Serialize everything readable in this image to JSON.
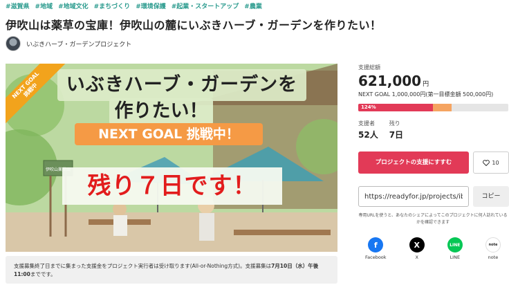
{
  "tags": [
    "#滋賀県",
    "#地域",
    "#地域文化",
    "#まちづくり",
    "#環境保護",
    "#起業・スタートアップ",
    "#農業"
  ],
  "title": "伊吹山は薬草の宝庫！伊吹山の麓にいぶきハーブ・ガーデンを作りたい！",
  "owner": {
    "name": "いぶきハーブ・ガーデンプロジェクト"
  },
  "hero": {
    "ribbon": "NEXT GOAL\n挑戦中",
    "line1": "いぶきハーブ・ガーデンを",
    "line2": "作りたい！",
    "goal": "NEXT GOAL 挑戦中！",
    "days_left": "残り７日です！",
    "sign": "伊吹山薬草園"
  },
  "notice": {
    "text_a": "支援募集終了日までに集まった支援金をプロジェクト実行者は受け取ります(All-or-Nothing方式)。支援募集は",
    "text_b": "7月10日（水）午後11:00",
    "text_c": "までです。"
  },
  "funding": {
    "label": "支援総額",
    "amount": "621,000",
    "unit": "円",
    "goal_text": "NEXT GOAL 1,000,000円(第一目標金額 500,000円)",
    "percent_label": "124%",
    "progress": 0.621,
    "first_goal_fraction": 0.5
  },
  "stats": {
    "supporters_label": "支援者",
    "supporters_value": "52人",
    "remaining_label": "残り",
    "remaining_value": "7日"
  },
  "actions": {
    "support_label": "プロジェクトの支援にすすむ",
    "fav_count": "10",
    "share_url": "https://readyfor.jp/projects/ibuki-herb",
    "copy_label": "コピー",
    "share_note": "専用URLを使うと、あなたのシェアによってこのプロジェクトに何人訪れているかを確認できます"
  },
  "sns": [
    {
      "label": "Facebook",
      "icon": "facebook-icon",
      "color": "#1877f2",
      "glyph": "f"
    },
    {
      "label": "X",
      "icon": "x-icon",
      "color": "#000000",
      "glyph": "X"
    },
    {
      "label": "LINE",
      "icon": "line-icon",
      "color": "#06c755",
      "glyph": "L"
    },
    {
      "label": "note",
      "icon": "note-icon",
      "color": "#ffffff",
      "glyph": "note"
    }
  ],
  "colors": {
    "accent": "#e23a57",
    "tag": "#2b9b8e",
    "goal": "#f59a45"
  }
}
